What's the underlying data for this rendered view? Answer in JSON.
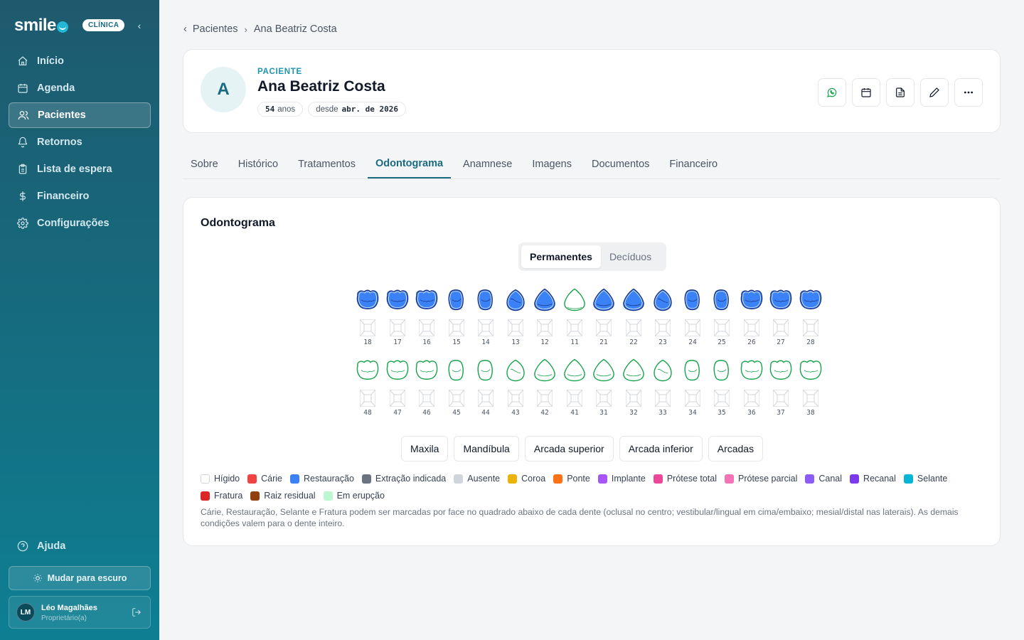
{
  "brand": {
    "name": "smile",
    "badge": "CLÍNICA"
  },
  "sidebar": {
    "items": [
      {
        "label": "Início",
        "icon": "home-icon",
        "active": false
      },
      {
        "label": "Agenda",
        "icon": "calendar-icon",
        "active": false
      },
      {
        "label": "Pacientes",
        "icon": "users-icon",
        "active": true
      },
      {
        "label": "Retornos",
        "icon": "bell-icon",
        "active": false
      },
      {
        "label": "Lista de espera",
        "icon": "clipboard-icon",
        "active": false
      },
      {
        "label": "Financeiro",
        "icon": "dollar-icon",
        "active": false
      },
      {
        "label": "Configurações",
        "icon": "gear-icon",
        "active": false
      }
    ],
    "help": "Ajuda",
    "theme_toggle": "Mudar para escuro",
    "user": {
      "initials": "LM",
      "name": "Léo Magalhães",
      "role": "Proprietário(a)"
    }
  },
  "breadcrumb": {
    "parent": "Pacientes",
    "current": "Ana Beatriz Costa"
  },
  "patient": {
    "initial": "A",
    "label": "PACIENTE",
    "name": "Ana Beatriz Costa",
    "age_value": "54",
    "age_unit": "anos",
    "since_prefix": "desde",
    "since_value": "abr. de 2026"
  },
  "tabs": [
    "Sobre",
    "Histórico",
    "Tratamentos",
    "Odontograma",
    "Anamnese",
    "Imagens",
    "Documentos",
    "Financeiro"
  ],
  "active_tab": "Odontograma",
  "odontogram": {
    "title": "Odontograma",
    "modes": [
      "Permanentes",
      "Decíduos"
    ],
    "active_mode": "Permanentes",
    "upper_teeth": [
      {
        "n": "18",
        "status": "restauracao",
        "shape": "molar"
      },
      {
        "n": "17",
        "status": "restauracao",
        "shape": "molar"
      },
      {
        "n": "16",
        "status": "restauracao",
        "shape": "molar"
      },
      {
        "n": "15",
        "status": "restauracao",
        "shape": "premolar"
      },
      {
        "n": "14",
        "status": "restauracao",
        "shape": "premolar"
      },
      {
        "n": "13",
        "status": "restauracao",
        "shape": "canine"
      },
      {
        "n": "12",
        "status": "restauracao",
        "shape": "incisor"
      },
      {
        "n": "11",
        "status": "higido",
        "shape": "incisor"
      },
      {
        "n": "21",
        "status": "restauracao",
        "shape": "incisor"
      },
      {
        "n": "22",
        "status": "restauracao",
        "shape": "incisor"
      },
      {
        "n": "23",
        "status": "restauracao",
        "shape": "canine"
      },
      {
        "n": "24",
        "status": "restauracao",
        "shape": "premolar"
      },
      {
        "n": "25",
        "status": "restauracao",
        "shape": "premolar"
      },
      {
        "n": "26",
        "status": "restauracao",
        "shape": "molar"
      },
      {
        "n": "27",
        "status": "restauracao",
        "shape": "molar"
      },
      {
        "n": "28",
        "status": "restauracao",
        "shape": "molar"
      }
    ],
    "lower_teeth": [
      {
        "n": "48",
        "status": "higido",
        "shape": "molar"
      },
      {
        "n": "47",
        "status": "higido",
        "shape": "molar"
      },
      {
        "n": "46",
        "status": "higido",
        "shape": "molar"
      },
      {
        "n": "45",
        "status": "higido",
        "shape": "premolar"
      },
      {
        "n": "44",
        "status": "higido",
        "shape": "premolar"
      },
      {
        "n": "43",
        "status": "higido",
        "shape": "canine"
      },
      {
        "n": "42",
        "status": "higido",
        "shape": "incisor"
      },
      {
        "n": "41",
        "status": "higido",
        "shape": "incisor"
      },
      {
        "n": "31",
        "status": "higido",
        "shape": "incisor"
      },
      {
        "n": "32",
        "status": "higido",
        "shape": "incisor"
      },
      {
        "n": "33",
        "status": "higido",
        "shape": "canine"
      },
      {
        "n": "34",
        "status": "higido",
        "shape": "premolar"
      },
      {
        "n": "35",
        "status": "higido",
        "shape": "premolar"
      },
      {
        "n": "36",
        "status": "higido",
        "shape": "molar"
      },
      {
        "n": "37",
        "status": "higido",
        "shape": "molar"
      },
      {
        "n": "38",
        "status": "higido",
        "shape": "molar"
      }
    ],
    "region_buttons": [
      "Maxila",
      "Mandíbula",
      "Arcada superior",
      "Arcada inferior",
      "Arcadas"
    ],
    "legend": [
      {
        "label": "Hígido",
        "color": "#ffffff"
      },
      {
        "label": "Cárie",
        "color": "#ef4444"
      },
      {
        "label": "Restauração",
        "color": "#3b82f6"
      },
      {
        "label": "Extração indicada",
        "color": "#6b7280"
      },
      {
        "label": "Ausente",
        "color": "#d1d5db"
      },
      {
        "label": "Coroa",
        "color": "#eab308"
      },
      {
        "label": "Ponte",
        "color": "#f97316"
      },
      {
        "label": "Implante",
        "color": "#a855f7"
      },
      {
        "label": "Prótese total",
        "color": "#ec4899"
      },
      {
        "label": "Prótese parcial",
        "color": "#f472b6"
      },
      {
        "label": "Canal",
        "color": "#8b5cf6"
      },
      {
        "label": "Recanal",
        "color": "#7c3aed"
      },
      {
        "label": "Selante",
        "color": "#06b6d4"
      },
      {
        "label": "Fratura",
        "color": "#dc2626"
      },
      {
        "label": "Raiz residual",
        "color": "#92400e"
      },
      {
        "label": "Em erupção",
        "color": "#bbf7d0"
      }
    ],
    "note": "Cárie, Restauração, Selante e Fratura podem ser marcadas por face no quadrado abaixo de cada dente (oclusal no centro; vestibular/lingual em cima/embaixo; mesial/distal nas laterais). As demais condições valem para o dente inteiro."
  },
  "colors": {
    "restoration_fill": "#3b82f6",
    "restoration_stroke": "#1e3a8a",
    "healthy_stroke": "#16a34a",
    "accent": "#1a6b80"
  }
}
